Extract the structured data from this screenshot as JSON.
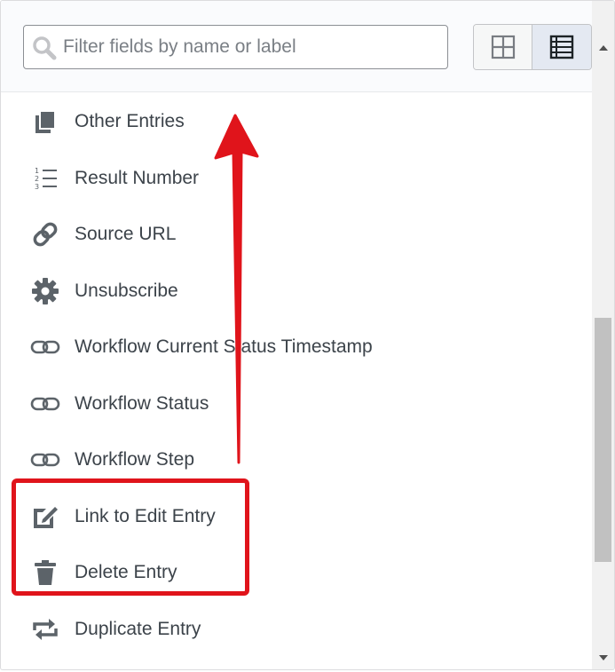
{
  "search": {
    "placeholder": "Filter fields by name or label",
    "value": ""
  },
  "view_toggle": {
    "active": "list"
  },
  "fields": [
    {
      "label": "Other Entries",
      "icon": "copy-icon"
    },
    {
      "label": "Result Number",
      "icon": "ordered-list-icon"
    },
    {
      "label": "Source URL",
      "icon": "link-icon"
    },
    {
      "label": "Unsubscribe",
      "icon": "gear-icon"
    },
    {
      "label": "Workflow Current Status Timestamp",
      "icon": "chain-icon"
    },
    {
      "label": "Workflow Status",
      "icon": "chain-icon"
    },
    {
      "label": "Workflow Step",
      "icon": "chain-icon"
    },
    {
      "label": "Link to Edit Entry",
      "icon": "edit-icon"
    },
    {
      "label": "Delete Entry",
      "icon": "trash-icon"
    },
    {
      "label": "Duplicate Entry",
      "icon": "repeat-icon"
    }
  ],
  "colors": {
    "icon": "#5c6369",
    "text": "#3c434a",
    "annotation": "#e0141b"
  }
}
